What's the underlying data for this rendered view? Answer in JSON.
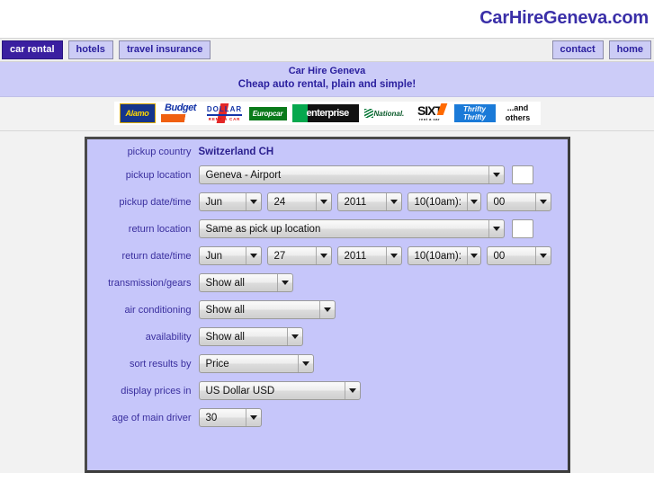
{
  "header": {
    "brand": "CarHireGeneva.com"
  },
  "nav": {
    "left_items": [
      {
        "label": "car rental",
        "active": true
      },
      {
        "label": "hotels",
        "active": false
      },
      {
        "label": "travel insurance",
        "active": false
      }
    ],
    "right_items": [
      {
        "label": "contact"
      },
      {
        "label": "home"
      }
    ]
  },
  "title_band": {
    "line1": "Car Hire Geneva",
    "line2": "Cheap auto rental, plain and simple!"
  },
  "logos": [
    {
      "name": "alamo",
      "text": "Alamo"
    },
    {
      "name": "budget",
      "text": "Budget"
    },
    {
      "name": "dollar",
      "text": "DOLLAR",
      "sub": "RENT A CAR"
    },
    {
      "name": "europcar",
      "text": "Europcar"
    },
    {
      "name": "enterprise",
      "text": "enterprise"
    },
    {
      "name": "national",
      "text": "National."
    },
    {
      "name": "sixt",
      "text": "SIXT",
      "sub": "rent a car"
    },
    {
      "name": "thrifty",
      "text": "Thrifty"
    },
    {
      "name": "others",
      "line1": "...and",
      "line2": "others"
    }
  ],
  "form": {
    "pickup_country": {
      "label": "pickup country",
      "value": "Switzerland CH"
    },
    "pickup_location": {
      "label": "pickup location",
      "value": "Geneva - Airport"
    },
    "pickup_datetime": {
      "label": "pickup date/time",
      "month": "Jun",
      "day": "24",
      "year": "2011",
      "hour": "10(10am):",
      "minute": "00"
    },
    "return_location": {
      "label": "return location",
      "value": "Same as pick up location"
    },
    "return_datetime": {
      "label": "return date/time",
      "month": "Jun",
      "day": "27",
      "year": "2011",
      "hour": "10(10am):",
      "minute": "00"
    },
    "transmission": {
      "label": "transmission/gears",
      "value": "Show all"
    },
    "air_conditioning": {
      "label": "air conditioning",
      "value": "Show all"
    },
    "availability": {
      "label": "availability",
      "value": "Show all"
    },
    "sort_results": {
      "label": "sort results by",
      "value": "Price"
    },
    "display_prices": {
      "label": "display prices in",
      "value": "US Dollar USD"
    },
    "driver_age": {
      "label": "age of main driver",
      "value": "30"
    }
  },
  "colors": {
    "brand_purple": "#3a2fa8",
    "nav_button_bg": "#ccccf5",
    "nav_active_bg": "#3a1fa0",
    "title_band_bg": "#ccccf8",
    "panel_bg": "#c6c6fa",
    "label_text": "#3a2f9e"
  }
}
